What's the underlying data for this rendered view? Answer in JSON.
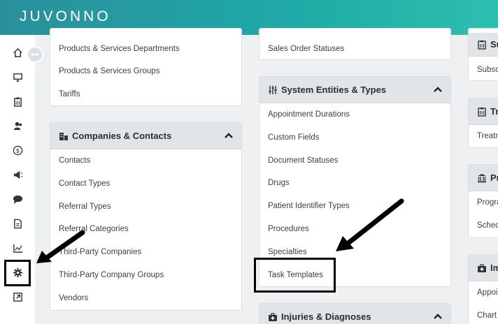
{
  "app": {
    "logo": "JUVONNO"
  },
  "sidebar": {
    "icons": [
      "home-icon",
      "monitor-icon",
      "clipboard-icon",
      "users-icon",
      "dollar-icon",
      "megaphone-icon",
      "chat-icon",
      "document-icon",
      "chart-icon",
      "gear-icon",
      "external-link-icon"
    ]
  },
  "col1": {
    "products_card": {
      "items": [
        "Products & Services Departments",
        "Products & Services Groups",
        "Tariffs"
      ]
    },
    "companies_card": {
      "title": "Companies & Contacts",
      "items": [
        "Contacts",
        "Contact Types",
        "Referral Types",
        "Referral Categories",
        "Third-Party Companies",
        "Third-Party Company Groups",
        "Vendors"
      ]
    }
  },
  "col2": {
    "sales_card": {
      "items": [
        "Sales Order Statuses"
      ]
    },
    "system_card": {
      "title": "System Entities & Types",
      "items": [
        "Appointment Durations",
        "Custom Fields",
        "Document Statuses",
        "Drugs",
        "Patient Identifier Types",
        "Procedures",
        "Specialties",
        "Task Templates"
      ]
    },
    "injuries_card": {
      "title": "Injuries & Diagnoses"
    }
  },
  "col3": {
    "subs_card": {
      "title": "Su",
      "items": [
        "Subscr"
      ]
    },
    "treat_card": {
      "title": "Tr",
      "items": [
        "Treatn"
      ]
    },
    "prog_card": {
      "title": "Pr",
      "items": [
        "Progra",
        "Sched"
      ]
    },
    "imm_card": {
      "title": "Im",
      "items": [
        "Appoi",
        "Chart"
      ]
    }
  },
  "colors": {
    "brand_teal": "#1fa8a6",
    "header_gray": "#e2e5e8"
  }
}
